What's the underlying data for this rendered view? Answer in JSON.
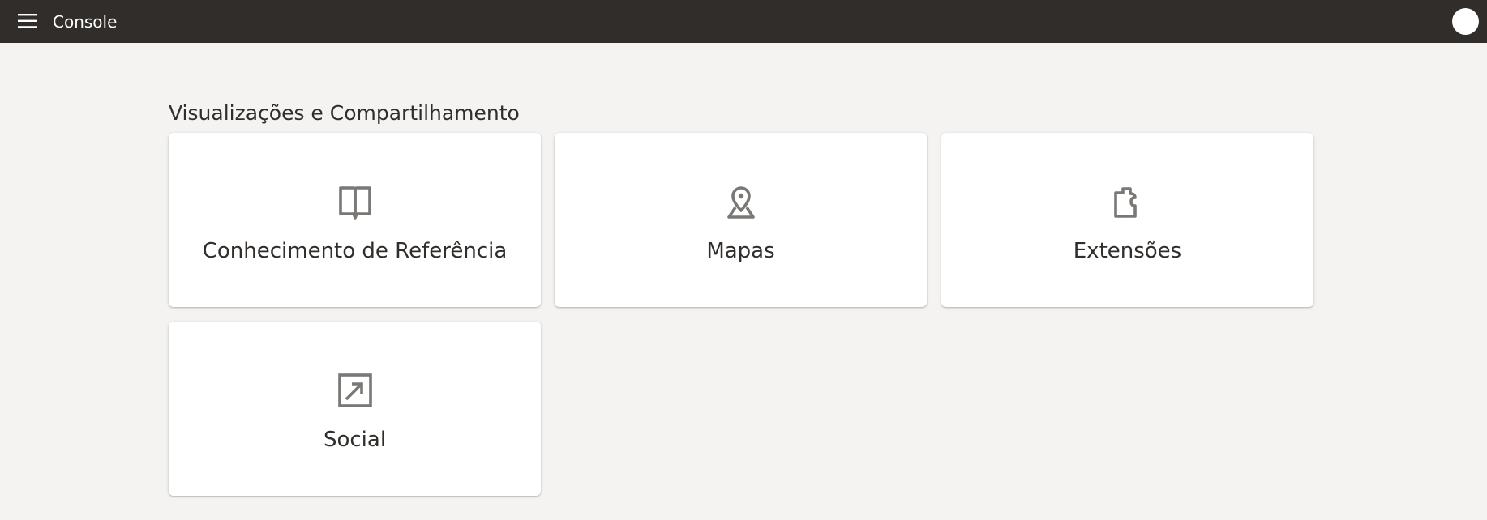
{
  "header": {
    "title": "Console",
    "menu_icon": "hamburger-menu-icon",
    "avatar_icon": "user-avatar"
  },
  "section": {
    "title": "Visualizações e Compartilhamento",
    "cards": [
      {
        "label": "Conhecimento de Referência",
        "icon": "open-book-icon"
      },
      {
        "label": "Mapas",
        "icon": "map-pin-icon"
      },
      {
        "label": "Extensões",
        "icon": "puzzle-piece-icon"
      },
      {
        "label": "Social",
        "icon": "share-external-icon"
      }
    ]
  },
  "colors": {
    "header_bg": "#312d2a",
    "page_bg": "#f4f3f1",
    "card_bg": "#ffffff",
    "icon": "#7a7774",
    "text": "#312d2a"
  }
}
